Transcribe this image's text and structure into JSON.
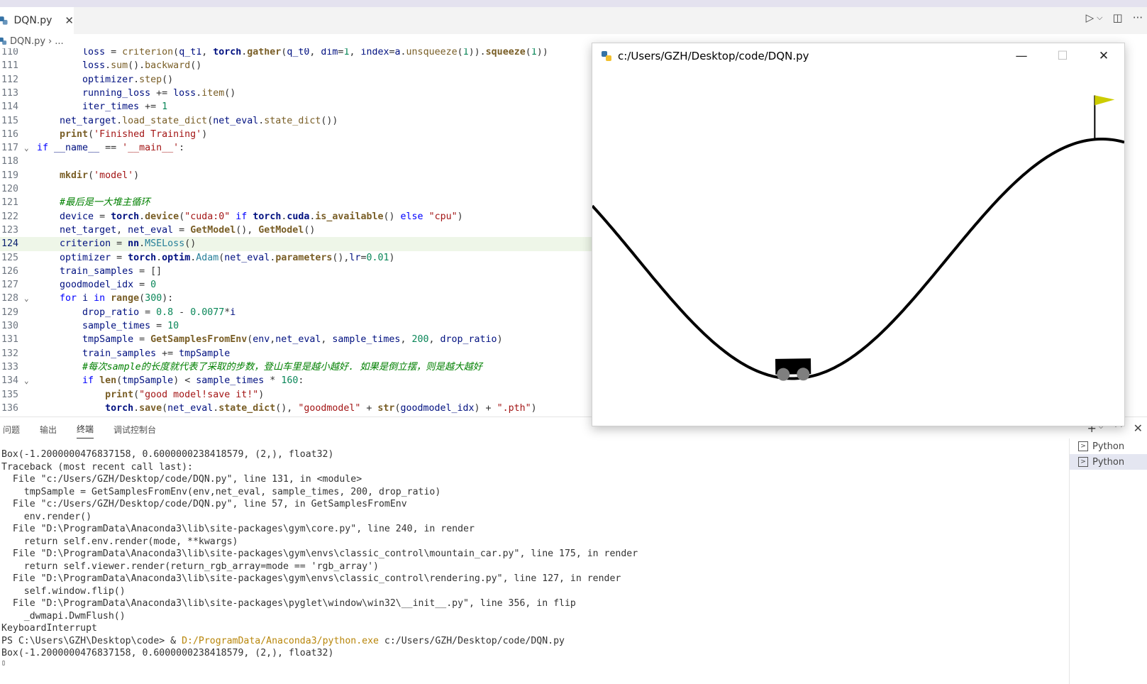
{
  "editor": {
    "tab_label": "DQN.py",
    "tab_close": "✕",
    "breadcrumb_file": "DQN.py",
    "breadcrumb_sep": "›",
    "breadcrumb_more": "..."
  },
  "toolbar": {
    "run_icon": "▷",
    "dropdown": "⌵",
    "split_icon": "◫",
    "more": "···"
  },
  "code_lines": [
    {
      "n": "110",
      "html": "        <span class='var'>loss</span> = <span class='fn'>criterion</span>(<span class='var'>q_t1</span>, <span class='bold'>torch</span>.<span class='fnb'>gather</span>(<span class='var'>q_t0</span>, <span class='prm'>dim</span>=<span class='num'>1</span>, <span class='prm'>index</span>=<span class='var'>a</span>.<span class='fn'>unsqueeze</span>(<span class='num'>1</span>)).<span class='fnb'>squeeze</span>(<span class='num'>1</span>))"
    },
    {
      "n": "111",
      "html": "        <span class='var'>loss</span>.<span class='fn'>sum</span>().<span class='fn'>backward</span>()"
    },
    {
      "n": "112",
      "html": "        <span class='var'>optimizer</span>.<span class='fn'>step</span>()"
    },
    {
      "n": "113",
      "html": "        <span class='var'>running_loss</span> += <span class='var'>loss</span>.<span class='fn'>item</span>()"
    },
    {
      "n": "114",
      "html": "        <span class='var'>iter_times</span> += <span class='num'>1</span>"
    },
    {
      "n": "115",
      "html": "    <span class='var'>net_target</span>.<span class='fn'>load_state_dict</span>(<span class='var'>net_eval</span>.<span class='fn'>state_dict</span>())"
    },
    {
      "n": "116",
      "html": "    <span class='fnb'>print</span>(<span class='str'>'Finished Training'</span>)"
    },
    {
      "n": "117",
      "fold": "⌄",
      "html": "<span class='kw'>if</span> <span class='var'>__name__</span> == <span class='str'>'__main__'</span>:"
    },
    {
      "n": "118",
      "html": ""
    },
    {
      "n": "119",
      "html": "    <span class='fnb'>mkdir</span>(<span class='str'>'model'</span>)"
    },
    {
      "n": "120",
      "html": ""
    },
    {
      "n": "121",
      "html": "    <span class='cmt'>#最后是一大堆主循环</span>"
    },
    {
      "n": "122",
      "html": "    <span class='var'>device</span> = <span class='bold'>torch</span>.<span class='fnb'>device</span>(<span class='str'>\"cuda:0\"</span> <span class='kw'>if</span> <span class='bold'>torch</span>.<span class='bold'>cuda</span>.<span class='fnb'>is_available</span>() <span class='kw'>else</span> <span class='str'>\"cpu\"</span>)"
    },
    {
      "n": "123",
      "html": "    <span class='var'>net_target</span>, <span class='var'>net_eval</span> = <span class='fnb'>GetModel</span>(), <span class='fnb'>GetModel</span>()"
    },
    {
      "n": "124",
      "active": true,
      "html": "    <span class='var'>criterion</span> = <span class='bold'>nn</span>.<span class='cls'>MSELoss</span>()"
    },
    {
      "n": "125",
      "html": "    <span class='var'>optimizer</span> = <span class='bold'>torch</span>.<span class='bold'>optim</span>.<span class='cls'>Adam</span>(<span class='var'>net_eval</span>.<span class='fnb'>parameters</span>(),<span class='prm'>lr</span>=<span class='num'>0.01</span>)"
    },
    {
      "n": "126",
      "html": "    <span class='var'>train_samples</span> = []"
    },
    {
      "n": "127",
      "html": "    <span class='var'>goodmodel_idx</span> = <span class='num'>0</span>"
    },
    {
      "n": "128",
      "fold": "⌄",
      "html": "    <span class='kw'>for</span> <span class='var'>i</span> <span class='kw'>in</span> <span class='fnb'>range</span>(<span class='num'>300</span>):"
    },
    {
      "n": "129",
      "html": "        <span class='var'>drop_ratio</span> = <span class='num'>0.8</span> - <span class='num'>0.0077</span>*<span class='var'>i</span>"
    },
    {
      "n": "130",
      "html": "        <span class='var'>sample_times</span> = <span class='num'>10</span>"
    },
    {
      "n": "131",
      "html": "        <span class='var'>tmpSample</span> = <span class='fnb'>GetSamplesFromEnv</span>(<span class='var'>env</span>,<span class='var'>net_eval</span>, <span class='var'>sample_times</span>, <span class='num'>200</span>, <span class='var'>drop_ratio</span>)"
    },
    {
      "n": "132",
      "html": "        <span class='var'>train_samples</span> += <span class='var'>tmpSample</span>"
    },
    {
      "n": "133",
      "html": "        <span class='cmt'>#每次sample的长度就代表了采取的步数，登山车里是越小越好. 如果是倒立摆，则是越大越好</span>"
    },
    {
      "n": "134",
      "fold": "⌄",
      "html": "        <span class='kw'>if</span> <span class='fnb'>len</span>(<span class='var'>tmpSample</span>) &lt; <span class='var'>sample_times</span> * <span class='num'>160</span>:"
    },
    {
      "n": "135",
      "html": "            <span class='fnb'>print</span>(<span class='str'>\"good model!save it!\"</span>)"
    },
    {
      "n": "136",
      "html": "            <span class='bold'>torch</span>.<span class='fnb'>save</span>(<span class='var'>net_eval</span>.<span class='fnb'>state_dict</span>(), <span class='str'>\"goodmodel\"</span> + <span class='fnb'>str</span>(<span class='var'>goodmodel_idx</span>) + <span class='str'>\".pth\"</span>)"
    }
  ],
  "panel": {
    "tabs": [
      "问题",
      "输出",
      "终端",
      "调试控制台"
    ],
    "active_tab": 2,
    "plus": "+",
    "chevron": "⌵",
    "up": "^",
    "close": "✕",
    "terminals": [
      "Python",
      "Python"
    ]
  },
  "terminal": {
    "lines_before": [
      "Box(-1.2000000476837158, 0.6000000238418579, (2,), float32)",
      "Traceback (most recent call last):",
      "  File \"c:/Users/GZH/Desktop/code/DQN.py\", line 131, in <module>",
      "    tmpSample = GetSamplesFromEnv(env,net_eval, sample_times, 200, drop_ratio)",
      "  File \"c:/Users/GZH/Desktop/code/DQN.py\", line 57, in GetSamplesFromEnv",
      "    env.render()",
      "  File \"D:\\ProgramData\\Anaconda3\\lib\\site-packages\\gym\\core.py\", line 240, in render",
      "    return self.env.render(mode, **kwargs)",
      "  File \"D:\\ProgramData\\Anaconda3\\lib\\site-packages\\gym\\envs\\classic_control\\mountain_car.py\", line 175, in render",
      "    return self.viewer.render(return_rgb_array=mode == 'rgb_array')",
      "  File \"D:\\ProgramData\\Anaconda3\\lib\\site-packages\\gym\\envs\\classic_control\\rendering.py\", line 127, in render",
      "    self.window.flip()",
      "  File \"D:\\ProgramData\\Anaconda3\\lib\\site-packages\\pyglet\\window\\win32\\__init__.py\", line 356, in flip",
      "    _dwmapi.DwmFlush()",
      "KeyboardInterrupt"
    ],
    "prompt": "PS C:\\Users\\GZH\\Desktop\\code> & ",
    "prompt_exe": "D:/ProgramData/Anaconda3/python.exe",
    "prompt_arg": " c:/Users/GZH/Desktop/code/DQN.py",
    "last_line": "Box(-1.2000000476837158, 0.6000000238418579, (2,), float32)",
    "cursor": "▯"
  },
  "game_window": {
    "title": "c:/Users/GZH/Desktop/code/DQN.py",
    "minimize": "—",
    "maximize": "☐",
    "close": "✕",
    "car_position": -0.52,
    "goal_position": 0.5,
    "x_range": [
      -1.2,
      0.6
    ],
    "flag_color": "#cccc00"
  }
}
